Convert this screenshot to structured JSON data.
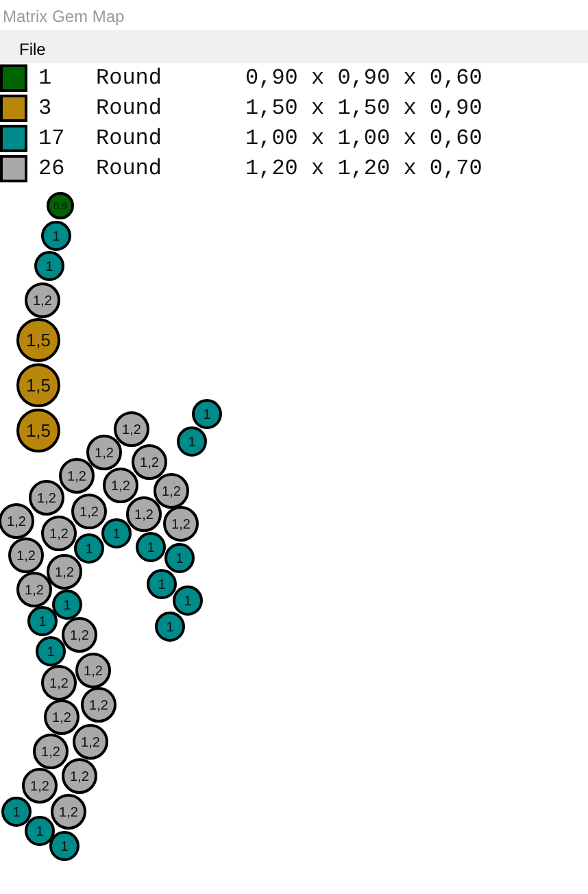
{
  "window": {
    "title": "Matrix Gem Map"
  },
  "menu": [
    "File"
  ],
  "legend": [
    {
      "color": "#006400",
      "count": "1",
      "shape": "Round",
      "size": "0,90 x 0,90 x 0,60"
    },
    {
      "color": "#b8860b",
      "count": "3",
      "shape": "Round",
      "size": "1,50 x 1,50 x 0,90"
    },
    {
      "color": "#008b8b",
      "count": "17",
      "shape": "Round",
      "size": "1,00 x 1,00 x 0,60"
    },
    {
      "color": "#a9a9a9",
      "count": "26",
      "shape": "Round",
      "size": "1,20 x 1,20 x 0,70"
    }
  ],
  "gems": [
    {
      "kind": "tiny",
      "color": "#006400",
      "label": "0,9"
    },
    {
      "kind": "small",
      "color": "#008b8b",
      "label": "1"
    },
    {
      "kind": "small",
      "color": "#008b8b",
      "label": "1"
    },
    {
      "kind": "medium",
      "color": "#a9a9a9",
      "label": "1,2"
    },
    {
      "kind": "large",
      "color": "#b8860b",
      "label": "1,5"
    },
    {
      "kind": "large",
      "color": "#b8860b",
      "label": "1,5"
    },
    {
      "kind": "large",
      "color": "#b8860b",
      "label": "1,5"
    },
    {
      "kind": "small",
      "color": "#008b8b",
      "label": "1"
    },
    {
      "kind": "small",
      "color": "#008b8b",
      "label": "1"
    },
    {
      "kind": "medium",
      "color": "#a9a9a9",
      "label": "1,2"
    },
    {
      "kind": "medium",
      "color": "#a9a9a9",
      "label": "1,2"
    },
    {
      "kind": "medium",
      "color": "#a9a9a9",
      "label": "1,2"
    },
    {
      "kind": "medium",
      "color": "#a9a9a9",
      "label": "1,2"
    },
    {
      "kind": "medium",
      "color": "#a9a9a9",
      "label": "1,2"
    },
    {
      "kind": "medium",
      "color": "#a9a9a9",
      "label": "1,2"
    },
    {
      "kind": "medium",
      "color": "#a9a9a9",
      "label": "1,2"
    },
    {
      "kind": "medium",
      "color": "#a9a9a9",
      "label": "1,2"
    },
    {
      "kind": "medium",
      "color": "#a9a9a9",
      "label": "1,2"
    },
    {
      "kind": "medium",
      "color": "#a9a9a9",
      "label": "1,2"
    },
    {
      "kind": "medium",
      "color": "#a9a9a9",
      "label": "1,2"
    },
    {
      "kind": "medium",
      "color": "#a9a9a9",
      "label": "1,2"
    },
    {
      "kind": "medium",
      "color": "#a9a9a9",
      "label": "1,2"
    },
    {
      "kind": "medium",
      "color": "#a9a9a9",
      "label": "1,2"
    },
    {
      "kind": "medium",
      "color": "#a9a9a9",
      "label": "1,2"
    },
    {
      "kind": "medium",
      "color": "#a9a9a9",
      "label": "1,2"
    },
    {
      "kind": "small",
      "color": "#008b8b",
      "label": "1"
    },
    {
      "kind": "small",
      "color": "#008b8b",
      "label": "1"
    },
    {
      "kind": "small",
      "color": "#008b8b",
      "label": "1"
    },
    {
      "kind": "small",
      "color": "#008b8b",
      "label": "1"
    },
    {
      "kind": "small",
      "color": "#008b8b",
      "label": "1"
    },
    {
      "kind": "small",
      "color": "#008b8b",
      "label": "1"
    },
    {
      "kind": "small",
      "color": "#008b8b",
      "label": "1"
    },
    {
      "kind": "small",
      "color": "#008b8b",
      "label": "1"
    },
    {
      "kind": "small",
      "color": "#008b8b",
      "label": "1"
    },
    {
      "kind": "small",
      "color": "#008b8b",
      "label": "1"
    },
    {
      "kind": "medium",
      "color": "#a9a9a9",
      "label": "1,2"
    },
    {
      "kind": "medium",
      "color": "#a9a9a9",
      "label": "1,2"
    },
    {
      "kind": "medium",
      "color": "#a9a9a9",
      "label": "1,2"
    },
    {
      "kind": "medium",
      "color": "#a9a9a9",
      "label": "1,2"
    },
    {
      "kind": "medium",
      "color": "#a9a9a9",
      "label": "1,2"
    },
    {
      "kind": "medium",
      "color": "#a9a9a9",
      "label": "1,2"
    },
    {
      "kind": "medium",
      "color": "#a9a9a9",
      "label": "1,2"
    },
    {
      "kind": "medium",
      "color": "#a9a9a9",
      "label": "1,2"
    },
    {
      "kind": "medium",
      "color": "#a9a9a9",
      "label": "1,2"
    },
    {
      "kind": "small",
      "color": "#008b8b",
      "label": "1"
    },
    {
      "kind": "small",
      "color": "#008b8b",
      "label": "1"
    },
    {
      "kind": "small",
      "color": "#008b8b",
      "label": "1"
    }
  ]
}
